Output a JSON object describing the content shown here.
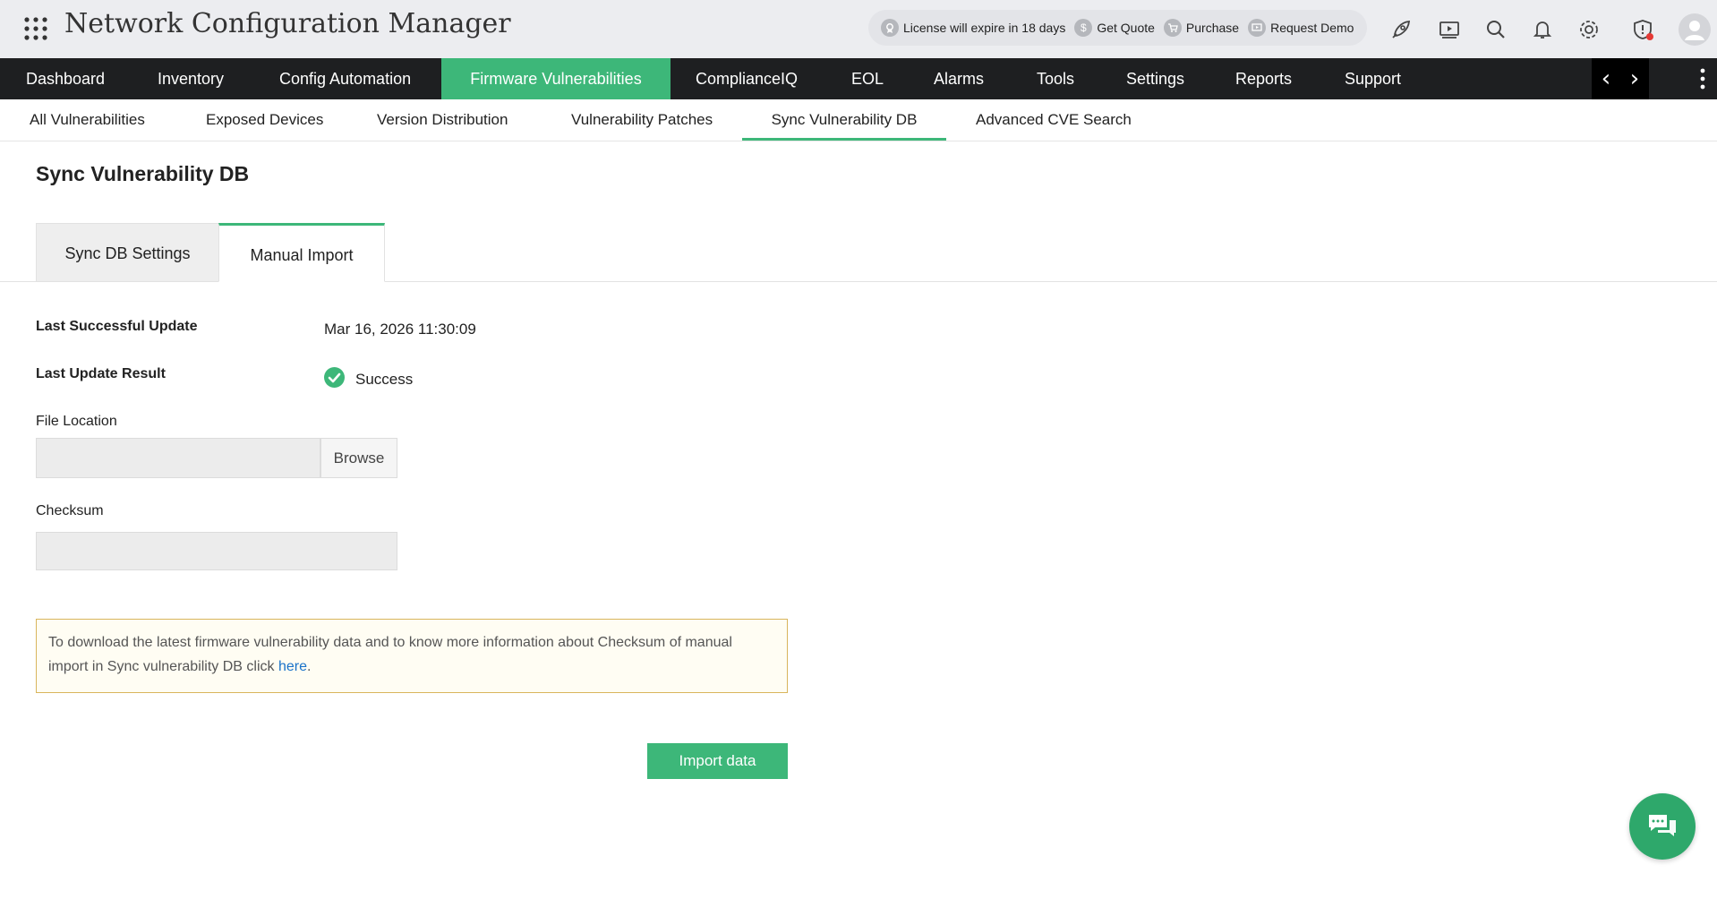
{
  "header": {
    "app_title": "Network Configuration Manager",
    "license_text": "License will expire in 18 days",
    "get_quote": "Get Quote",
    "purchase": "Purchase",
    "request_demo": "Request Demo",
    "license_icon": "license-icon",
    "quote_icon": "dollar-icon",
    "purchase_icon": "cart-icon",
    "demo_icon": "demo-icon",
    "notification_badge_color": "#e53935"
  },
  "main_nav": {
    "items": [
      {
        "label": "Dashboard"
      },
      {
        "label": "Inventory"
      },
      {
        "label": "Config Automation"
      },
      {
        "label": "Firmware Vulnerabilities",
        "active": true
      },
      {
        "label": "ComplianceIQ"
      },
      {
        "label": "EOL"
      },
      {
        "label": "Alarms"
      },
      {
        "label": "Tools"
      },
      {
        "label": "Settings"
      },
      {
        "label": "Reports"
      },
      {
        "label": "Support"
      }
    ],
    "prev_arrow": "‹",
    "next_arrow": "›",
    "background": "#1e1f21",
    "active_color": "#3db779"
  },
  "sub_nav": {
    "items": [
      {
        "label": "All Vulnerabilities"
      },
      {
        "label": "Exposed Devices"
      },
      {
        "label": "Version Distribution"
      },
      {
        "label": "Vulnerability Patches"
      },
      {
        "label": "Sync Vulnerability DB",
        "active": true
      },
      {
        "label": "Advanced CVE Search"
      }
    ]
  },
  "content": {
    "page_title": "Sync Vulnerability DB",
    "tabs": [
      {
        "label": "Sync DB Settings"
      },
      {
        "label": "Manual Import",
        "active": true
      }
    ],
    "last_update_label": "Last Successful Update",
    "last_update_value": "Mar 16, 2026 11:30:09",
    "last_result_label": "Last Update Result",
    "last_result_value": "Success",
    "file_location_label": "File Location",
    "file_location_value": "",
    "browse_label": "Browse",
    "checksum_label": "Checksum",
    "checksum_value": "",
    "info_text": "To download the latest firmware vulnerability data and to know more information about Checksum of manual import in Sync vulnerability DB click ",
    "info_link": "here",
    "info_suffix": ".",
    "import_button": "Import data",
    "accent_color": "#3db779"
  }
}
